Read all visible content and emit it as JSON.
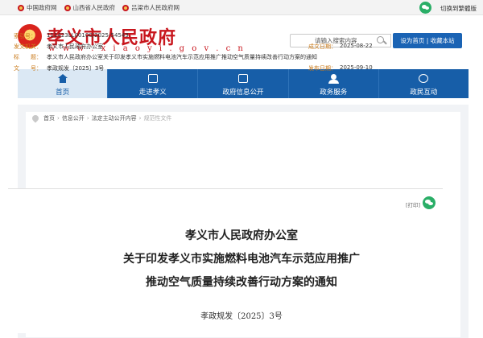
{
  "topbar": {
    "links": [
      "中国政府网",
      "山西省人民政府",
      "吕梁市人民政府网"
    ],
    "lang_switch": "切换到繁體版"
  },
  "header": {
    "title": "孝义市人民政府",
    "url": "w w w . x i a o y i . g o v . c n",
    "search_placeholder": "请输入搜索内容",
    "home_label": "设为首页 | 收藏本站"
  },
  "nav": {
    "items": [
      "首页",
      "走进孝义",
      "政府信息公开",
      "政务服务",
      "政民互动"
    ],
    "active": "首页"
  },
  "breadcrumb": {
    "items": [
      "首页",
      "信息公开",
      "法定主动公开内容"
    ],
    "current": "规范性文件"
  },
  "meta": {
    "index_label": "索引号：",
    "index_value": "111423LL00100/2025-54543",
    "org_label": "发文机关：",
    "org_value": "孝义市人民政府办公室",
    "date_label": "成文日期：",
    "date_value": "2025-08-22",
    "title_label": "标　　题：",
    "title_value": "孝义市人民政府办公室关于印发孝义市实施燃料电池汽车示范应用推广推动空气质量持续改善行动方案的通知",
    "num_label": "文　　号：",
    "num_value": "孝政规发〔2025〕3号",
    "pub_label": "发布日期：",
    "pub_value": "2025-09-10"
  },
  "actions": {
    "print": "[打印]"
  },
  "document": {
    "title_line1": "孝义市人民政府办公室",
    "title_line2": "关于印发孝义市实施燃料电池汽车示范应用推广",
    "title_line3": "推动空气质量持续改善行动方案的通知",
    "doc_number": "孝政规发〔2025〕3号"
  },
  "colors": {
    "brand_red": "#c8161d",
    "nav_blue": "#175ea8",
    "meta_label_orange": "#c97a1a"
  }
}
